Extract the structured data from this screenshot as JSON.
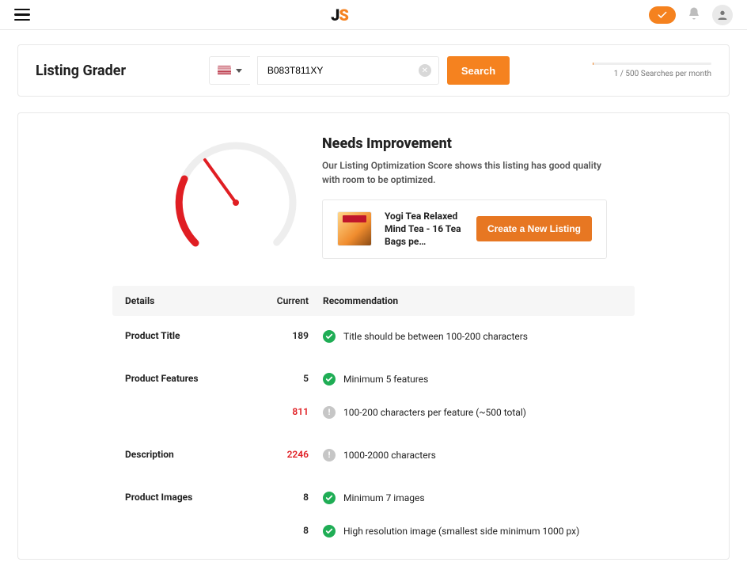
{
  "appbar": {
    "logo_j": "J",
    "logo_s": "S"
  },
  "header": {
    "title": "Listing Grader",
    "search_value": "B083T811XY",
    "search_button": "Search",
    "quota_text": "1 / 500 Searches per month"
  },
  "score": {
    "headline": "Needs Improvement",
    "subtext": "Our Listing Optimization Score shows this listing has good quality with room to be optimized.",
    "product_title": "Yogi Tea Relaxed Mind Tea - 16 Tea Bags pe…",
    "cta_label": "Create a New Listing"
  },
  "table": {
    "head_details": "Details",
    "head_current": "Current",
    "head_rec": "Recommendation",
    "rows": [
      {
        "detail": "Product Title",
        "lines": [
          {
            "current": "189",
            "bad": false,
            "icon": "ok",
            "rec": "Title should be between 100-200 characters"
          }
        ]
      },
      {
        "detail": "Product Features",
        "lines": [
          {
            "current": "5",
            "bad": false,
            "icon": "ok",
            "rec": "Minimum 5 features"
          },
          {
            "current": "811",
            "bad": true,
            "icon": "warn",
            "rec": "100-200 characters per feature (~500 total)"
          }
        ]
      },
      {
        "detail": "Description",
        "lines": [
          {
            "current": "2246",
            "bad": true,
            "icon": "warn",
            "rec": "1000-2000 characters"
          }
        ]
      },
      {
        "detail": "Product Images",
        "lines": [
          {
            "current": "8",
            "bad": false,
            "icon": "ok",
            "rec": "Minimum 7 images"
          },
          {
            "current": "8",
            "bad": false,
            "icon": "ok",
            "rec": "High resolution image (smallest side minimum 1000 px)"
          }
        ]
      }
    ]
  }
}
